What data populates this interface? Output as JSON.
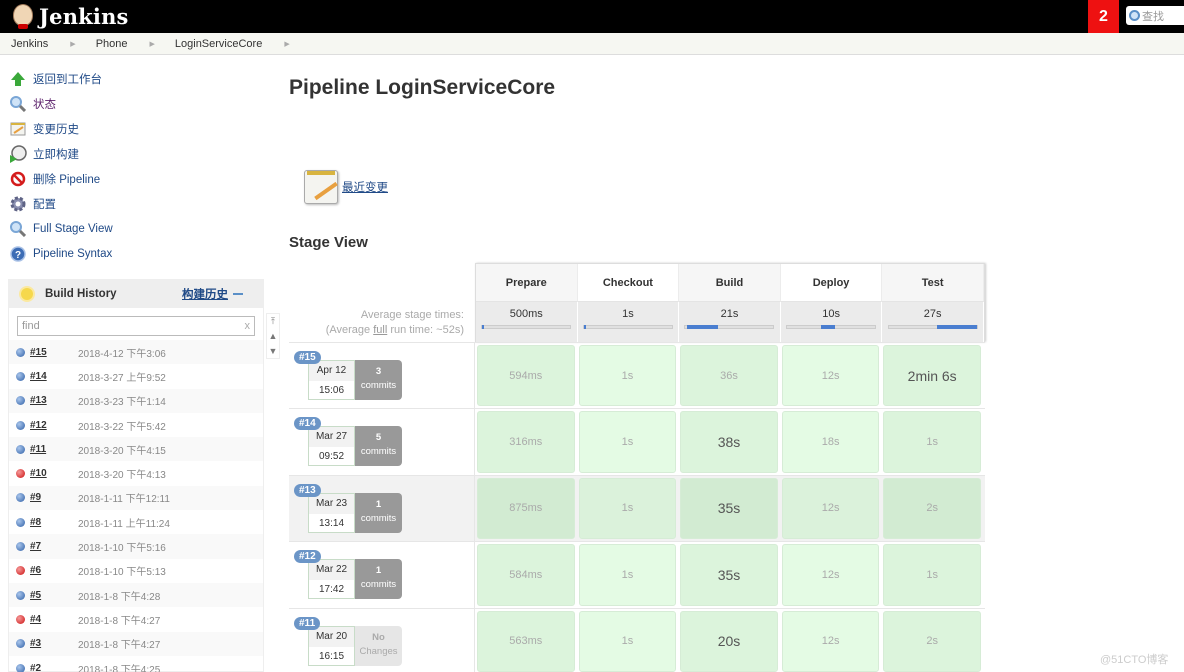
{
  "header": {
    "brand": "Jenkins",
    "notification_count": "2",
    "search_placeholder": "查找"
  },
  "breadcrumbs": [
    "Jenkins",
    "Phone",
    "LoginServiceCore"
  ],
  "tasks": [
    {
      "label": "返回到工作台",
      "icon": "up-arrow-icon"
    },
    {
      "label": "状态",
      "icon": "search-icon"
    },
    {
      "label": "变更历史",
      "icon": "notepad-icon"
    },
    {
      "label": "立即构建",
      "icon": "build-clock-icon"
    },
    {
      "label": "删除 Pipeline",
      "icon": "no-entry-icon"
    },
    {
      "label": "配置",
      "icon": "gear-icon"
    },
    {
      "label": "Full Stage View",
      "icon": "search-icon"
    },
    {
      "label": "Pipeline Syntax",
      "icon": "help-icon"
    }
  ],
  "build_history": {
    "title": "Build History",
    "trend_link": "构建历史",
    "find_placeholder": "find",
    "clear": "x",
    "builds": [
      {
        "num": "#15",
        "time": "2018-4-12 下午3:06",
        "status": "blue"
      },
      {
        "num": "#14",
        "time": "2018-3-27 上午9:52",
        "status": "blue"
      },
      {
        "num": "#13",
        "time": "2018-3-23 下午1:14",
        "status": "blue"
      },
      {
        "num": "#12",
        "time": "2018-3-22 下午5:42",
        "status": "blue"
      },
      {
        "num": "#11",
        "time": "2018-3-20 下午4:15",
        "status": "blue"
      },
      {
        "num": "#10",
        "time": "2018-3-20 下午4:13",
        "status": "red"
      },
      {
        "num": "#9",
        "time": "2018-1-11 下午12:11",
        "status": "blue"
      },
      {
        "num": "#8",
        "time": "2018-1-11 上午11:24",
        "status": "blue"
      },
      {
        "num": "#7",
        "time": "2018-1-10 下午5:16",
        "status": "blue"
      },
      {
        "num": "#6",
        "time": "2018-1-10 下午5:13",
        "status": "red"
      },
      {
        "num": "#5",
        "time": "2018-1-8 下午4:28",
        "status": "blue"
      },
      {
        "num": "#4",
        "time": "2018-1-8 下午4:27",
        "status": "red"
      },
      {
        "num": "#3",
        "time": "2018-1-8 下午4:27",
        "status": "blue"
      },
      {
        "num": "#2",
        "time": "2018-1-8 下午4:25",
        "status": "blue"
      }
    ]
  },
  "main": {
    "title": "Pipeline LoginServiceCore",
    "recent_changes": "最近变更",
    "stage_view_title": "Stage View",
    "avg_label_1": "Average stage times:",
    "avg_label_2_pre": "(Average ",
    "avg_label_2_link": "full",
    "avg_label_2_post": " run time: ~52s)",
    "stages": [
      {
        "name": "Prepare",
        "avg": "500ms",
        "bar_start": 0.0,
        "bar_fraction": 0.01
      },
      {
        "name": "Checkout",
        "avg": "1s",
        "bar_start": 0.0,
        "bar_fraction": 0.02
      },
      {
        "name": "Build",
        "avg": "21s",
        "bar_start": 0.02,
        "bar_fraction": 0.35
      },
      {
        "name": "Deploy",
        "avg": "10s",
        "bar_start": 0.38,
        "bar_fraction": 0.17
      },
      {
        "name": "Test",
        "avg": "27s",
        "bar_start": 0.55,
        "bar_fraction": 0.45
      }
    ],
    "runs": [
      {
        "badge": "#15",
        "date": "Apr 12",
        "time": "15:06",
        "commits_n": "3",
        "commits_label": "commits",
        "durations": [
          "594ms",
          "1s",
          "36s",
          "12s",
          "2min 6s"
        ],
        "big": [
          false,
          false,
          false,
          false,
          true
        ]
      },
      {
        "badge": "#14",
        "date": "Mar 27",
        "time": "09:52",
        "commits_n": "5",
        "commits_label": "commits",
        "durations": [
          "316ms",
          "1s",
          "38s",
          "18s",
          "1s"
        ],
        "big": [
          false,
          false,
          true,
          false,
          false
        ]
      },
      {
        "badge": "#13",
        "date": "Mar 23",
        "time": "13:14",
        "commits_n": "1",
        "commits_label": "commits",
        "durations": [
          "875ms",
          "1s",
          "35s",
          "12s",
          "2s"
        ],
        "big": [
          false,
          false,
          true,
          false,
          false
        ]
      },
      {
        "badge": "#12",
        "date": "Mar 22",
        "time": "17:42",
        "commits_n": "1",
        "commits_label": "commits",
        "durations": [
          "584ms",
          "1s",
          "35s",
          "12s",
          "1s"
        ],
        "big": [
          false,
          false,
          true,
          false,
          false
        ]
      },
      {
        "badge": "#11",
        "date": "Mar 20",
        "time": "16:15",
        "commits_n": "No",
        "commits_label": "Changes",
        "durations": [
          "563ms",
          "1s",
          "20s",
          "12s",
          "2s"
        ],
        "big": [
          false,
          false,
          true,
          false,
          false
        ],
        "no_changes": true
      }
    ]
  },
  "watermark": "@51CTO博客"
}
